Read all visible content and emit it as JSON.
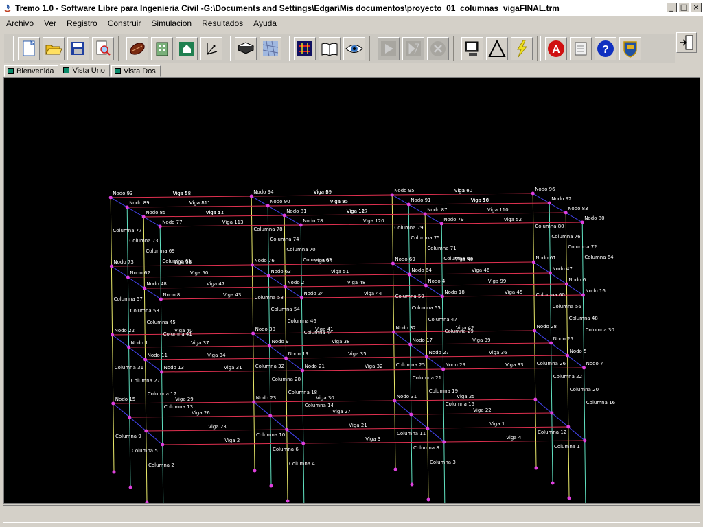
{
  "window": {
    "title": "Tremo 1.0 - Software Libre para Ingenieria Civil -G:\\Documents and Settings\\Edgar\\Mis documentos\\proyecto_01_columnas_vigaFINAL.trm",
    "minimize_glyph": "_",
    "maximize_glyph": "□",
    "close_glyph": "×"
  },
  "menu": [
    "Archivo",
    "Ver",
    "Registro",
    "Construir",
    "Simulacion",
    "Resultados",
    "Ayuda"
  ],
  "toolbar": {
    "buttons": [
      {
        "icon": "new-document-icon",
        "enabled": true
      },
      {
        "icon": "open-folder-icon",
        "enabled": true
      },
      {
        "icon": "save-icon",
        "enabled": true
      },
      {
        "icon": "print-preview-icon",
        "enabled": true
      },
      {
        "icon": "beam-icon",
        "enabled": true
      },
      {
        "icon": "building-icon",
        "enabled": true
      },
      {
        "icon": "house-icon",
        "enabled": true
      },
      {
        "icon": "axes-icon",
        "enabled": true
      },
      {
        "icon": "slab-icon",
        "enabled": true
      },
      {
        "icon": "mesh-icon",
        "enabled": true
      },
      {
        "icon": "structure-view-icon",
        "enabled": true
      },
      {
        "icon": "book-icon",
        "enabled": true
      },
      {
        "icon": "eye-icon",
        "enabled": true
      },
      {
        "icon": "play-icon",
        "enabled": false
      },
      {
        "icon": "step-icon",
        "enabled": false
      },
      {
        "icon": "stop-icon",
        "enabled": false
      },
      {
        "icon": "computer-icon",
        "enabled": true
      },
      {
        "icon": "delta-icon",
        "enabled": true
      },
      {
        "icon": "lightning-icon",
        "enabled": true
      },
      {
        "icon": "acrobat-icon",
        "enabled": true
      },
      {
        "icon": "scroll-icon",
        "enabled": true
      },
      {
        "icon": "help-icon",
        "enabled": true
      },
      {
        "icon": "crest-icon",
        "enabled": true
      }
    ],
    "exit_icon": "exit-door-icon"
  },
  "tabs": [
    {
      "label": "Bienvenida",
      "active": false
    },
    {
      "label": "Vista Uno",
      "active": true
    },
    {
      "label": "Vista Dos",
      "active": false
    }
  ],
  "colors": {
    "canvas_bg": "#000000",
    "node": "#e040e0",
    "column": "#e8e86a",
    "column_alt": "#60e0c0",
    "beam_x": "#e03050",
    "beam_y": "#4040e0",
    "label": "#ffffff"
  },
  "model_labels": {
    "nodes": [
      "Nodo 93",
      "Nodo 94",
      "Nodo 95",
      "Nodo 96",
      "Nodo 89",
      "Nodo 90",
      "Nodo 91",
      "Nodo 92",
      "Nodo 85",
      "Nodo 81",
      "Nodo 87",
      "Nodo 83",
      "Nodo 77",
      "Nodo 78",
      "Nodo 79",
      "Nodo 80",
      "Nodo 73",
      "Nodo 76",
      "Nodo 69",
      "Nodo 61",
      "Nodo 62",
      "Nodo 63",
      "Nodo 64",
      "Nodo 47",
      "Nodo 48",
      "Nodo 2",
      "Nodo 4",
      "Nodo 6",
      "Nodo 8",
      "Nodo 24",
      "Nodo 18",
      "Nodo 16",
      "Nodo 22",
      "Nodo 30",
      "Nodo 32",
      "Nodo 28",
      "Nodo 1",
      "Nodo 9",
      "Nodo 17",
      "Nodo 25",
      "Nodo 11",
      "Nodo 19",
      "Nodo 27",
      "Nodo 5",
      "Nodo 13",
      "Nodo 21",
      "Nodo 29",
      "Nodo 7",
      "Nodo 15",
      "Nodo 23",
      "Nodo 31"
    ],
    "beams": [
      "Viga 58",
      "Viga 59",
      "Viga 60",
      "Viga 111",
      "Viga 55",
      "Viga 56",
      "Viga 57",
      "Viga 117",
      "Viga 110",
      "Viga 113",
      "Viga 120",
      "Viga 52",
      "Viga 53",
      "Viga 54",
      "Viga 49",
      "Viga 50",
      "Viga 51",
      "Viga 46",
      "Viga 47",
      "Viga 48",
      "Viga 99",
      "Viga 43",
      "Viga 44",
      "Viga 45",
      "Viga 40",
      "Viga 41",
      "Viga 42",
      "Viga 37",
      "Viga 38",
      "Viga 39",
      "Viga 34",
      "Viga 35",
      "Viga 36",
      "Viga 31",
      "Viga 32",
      "Viga 33",
      "Viga 29",
      "Viga 30",
      "Viga 25",
      "Viga 26",
      "Viga 27",
      "Viga 22",
      "Viga 23",
      "Viga 21",
      "Viga 1",
      "Viga 2",
      "Viga 3",
      "Viga 4",
      "Viga 5",
      "Viga 6",
      "Viga 7",
      "Viga 8",
      "Viga 9",
      "Viga 10",
      "Viga 11",
      "Viga 12"
    ],
    "columns": [
      "Columna 77",
      "Columna 78",
      "Columna 79",
      "Columna 80",
      "Columna 73",
      "Columna 74",
      "Columna 75",
      "Columna 76",
      "Columna 69",
      "Columna 70",
      "Columna 71",
      "Columna 72",
      "Columna 61",
      "Columna 62",
      "Columna 63",
      "Columna 64",
      "Columna 57",
      "Columna 58",
      "Columna 59",
      "Columna 60",
      "Columna 53",
      "Columna 54",
      "Columna 55",
      "Columna 56",
      "Columna 45",
      "Columna 46",
      "Columna 47",
      "Columna 48",
      "Columna 41",
      "Columna 44",
      "Columna 29",
      "Columna 30",
      "Columna 31",
      "Columna 32",
      "Columna 25",
      "Columna 26",
      "Columna 27",
      "Columna 28",
      "Columna 21",
      "Columna 22",
      "Columna 17",
      "Columna 18",
      "Columna 19",
      "Columna 20",
      "Columna 13",
      "Columna 14",
      "Columna 15",
      "Columna 16",
      "Columna 9",
      "Columna 10",
      "Columna 11",
      "Columna 12",
      "Columna 5",
      "Columna 6",
      "Columna 8",
      "Columna 1",
      "Columna 2",
      "Columna 4",
      "Columna 3"
    ]
  }
}
